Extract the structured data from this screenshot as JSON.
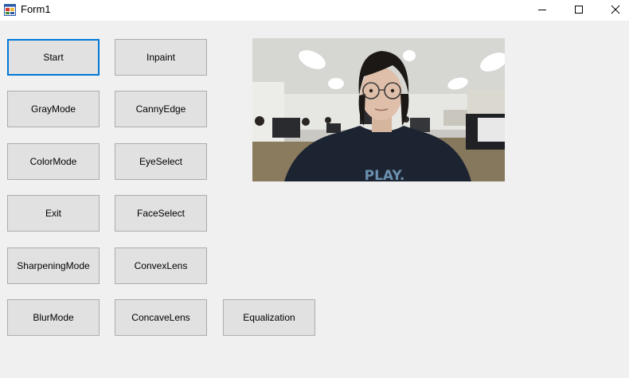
{
  "window": {
    "title": "Form1",
    "minimize_label": "Minimize",
    "maximize_label": "Maximize",
    "close_label": "Close"
  },
  "buttons": {
    "start": "Start",
    "inpaint": "Inpaint",
    "gray_mode": "GrayMode",
    "canny_edge": "CannyEdge",
    "color_mode": "ColorMode",
    "eye_select": "EyeSelect",
    "exit": "Exit",
    "face_select": "FaceSelect",
    "sharpening_mode": "SharpeningMode",
    "convex_lens": "ConvexLens",
    "blur_mode": "BlurMode",
    "concave_lens": "ConcaveLens",
    "equalization": "Equalization"
  },
  "camera": {
    "shirt_text": "PLAY."
  },
  "colors": {
    "focus_border": "#0078d7",
    "button_face": "#e1e1e1",
    "button_border": "#adadad",
    "form_background": "#f0f0f0"
  }
}
